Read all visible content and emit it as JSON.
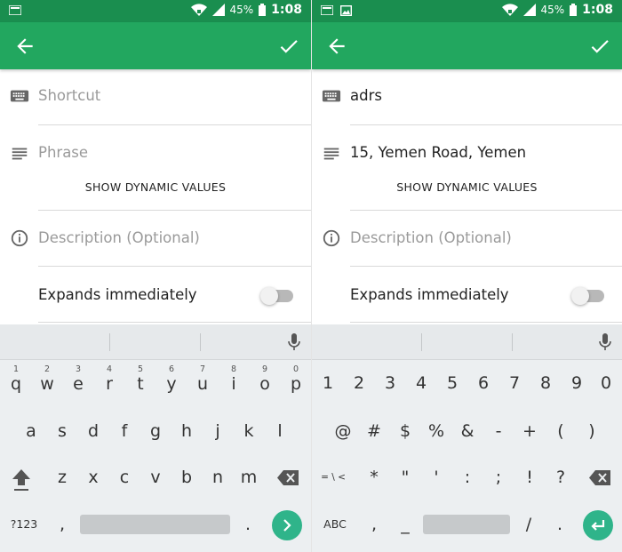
{
  "status": {
    "battery": "45%",
    "time": "1:08",
    "bg_color": "#1a8e4f"
  },
  "appbar": {
    "color": "#22a75f",
    "back_icon": "arrow-left-icon",
    "confirm_icon": "check-icon"
  },
  "left": {
    "shortcut": {
      "value": "",
      "placeholder": "Shortcut"
    },
    "phrase": {
      "value": "",
      "placeholder": "Phrase"
    },
    "dynamic_button": "SHOW DYNAMIC VALUES",
    "description": {
      "value": "",
      "placeholder": "Description (Optional)"
    },
    "expands_label": "Expands immediately",
    "expands_on": false,
    "keyboard": {
      "row1": [
        {
          "k": "q",
          "h": "1"
        },
        {
          "k": "w",
          "h": "2"
        },
        {
          "k": "e",
          "h": "3"
        },
        {
          "k": "r",
          "h": "4"
        },
        {
          "k": "t",
          "h": "5"
        },
        {
          "k": "y",
          "h": "6"
        },
        {
          "k": "u",
          "h": "7"
        },
        {
          "k": "i",
          "h": "8"
        },
        {
          "k": "o",
          "h": "9"
        },
        {
          "k": "p",
          "h": "0"
        }
      ],
      "row2": [
        "a",
        "s",
        "d",
        "f",
        "g",
        "h",
        "j",
        "k",
        "l"
      ],
      "row3": [
        "z",
        "x",
        "c",
        "v",
        "b",
        "n",
        "m"
      ],
      "symbols_key": "?123",
      "comma": ",",
      "period": "."
    }
  },
  "right": {
    "shortcut": {
      "value": "adrs",
      "placeholder": "Shortcut"
    },
    "phrase": {
      "value": "15, Yemen Road, Yemen",
      "placeholder": "Phrase"
    },
    "dynamic_button": "SHOW DYNAMIC VALUES",
    "description": {
      "value": "",
      "placeholder": "Description (Optional)"
    },
    "expands_label": "Expands immediately",
    "expands_on": false,
    "keyboard": {
      "row1": [
        "1",
        "2",
        "3",
        "4",
        "5",
        "6",
        "7",
        "8",
        "9",
        "0"
      ],
      "row2": [
        "@",
        "#",
        "$",
        "%",
        "&",
        "-",
        "+",
        "(",
        ")"
      ],
      "more_key": "= \\ <",
      "row3": [
        "*",
        "\"",
        "'",
        ":",
        ";",
        "!",
        "?"
      ],
      "abc_key": "ABC",
      "comma": ",",
      "underscore": "_",
      "slash": "/",
      "period": "."
    }
  },
  "accent_color": "#2fb48a"
}
